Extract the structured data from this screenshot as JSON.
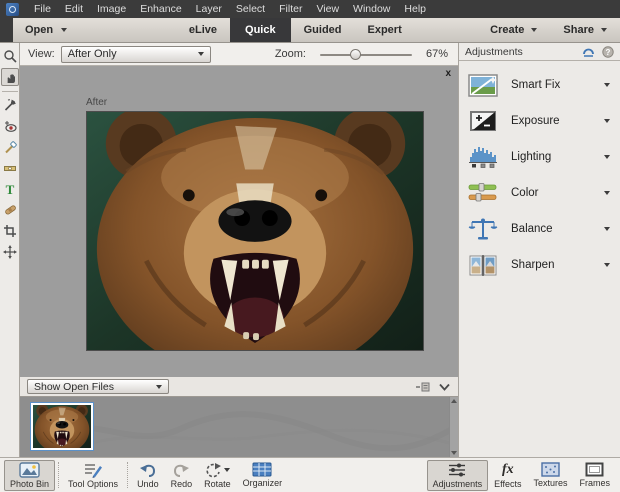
{
  "menubar": {
    "items": [
      "File",
      "Edit",
      "Image",
      "Enhance",
      "Layer",
      "Select",
      "Filter",
      "View",
      "Window",
      "Help"
    ]
  },
  "modebar": {
    "open_label": "Open",
    "tabs": [
      {
        "label": "eLive"
      },
      {
        "label": "Quick",
        "active": true
      },
      {
        "label": "Guided"
      },
      {
        "label": "Expert"
      }
    ],
    "create_label": "Create",
    "share_label": "Share"
  },
  "viewbar": {
    "view_label": "View:",
    "view_value": "After Only",
    "zoom_label": "Zoom:",
    "zoom_percent": "67%",
    "zoom_handle_position_pct": 33
  },
  "canvas": {
    "photo_label": "After",
    "close_glyph": "x"
  },
  "adjustments_panel": {
    "title": "Adjustments",
    "items": [
      {
        "label": "Smart Fix",
        "icon": "smart-fix-icon"
      },
      {
        "label": "Exposure",
        "icon": "exposure-icon"
      },
      {
        "label": "Lighting",
        "icon": "lighting-icon"
      },
      {
        "label": "Color",
        "icon": "color-icon"
      },
      {
        "label": "Balance",
        "icon": "balance-icon"
      },
      {
        "label": "Sharpen",
        "icon": "sharpen-icon"
      }
    ]
  },
  "binbar": {
    "dropdown_value": "Show Open Files"
  },
  "taskbar": {
    "left": [
      {
        "label": "Photo Bin",
        "icon": "photo-bin-icon",
        "active": true
      },
      {
        "label": "Tool Options",
        "icon": "tool-options-icon"
      },
      {
        "label": "Undo",
        "icon": "undo-icon"
      },
      {
        "label": "Redo",
        "icon": "redo-icon"
      },
      {
        "label": "Rotate",
        "icon": "rotate-icon"
      },
      {
        "label": "Organizer",
        "icon": "organizer-icon"
      }
    ],
    "right": [
      {
        "label": "Adjustments",
        "icon": "adjustments-sliders-icon",
        "active": true
      },
      {
        "label": "Effects",
        "icon": "effects-icon",
        "glyph": "fx"
      },
      {
        "label": "Textures",
        "icon": "textures-icon"
      },
      {
        "label": "Frames",
        "icon": "frames-icon"
      }
    ]
  },
  "tools": [
    "zoom-tool",
    "hand-tool",
    "quick-selection-tool",
    "red-eye-tool",
    "whiten-teeth-tool",
    "straighten-tool",
    "type-tool",
    "spot-healing-tool",
    "crop-tool",
    "move-tool"
  ],
  "colors": {
    "accent_blue": "#3f76b4",
    "tab_dark": "#38383a",
    "menubar_bg": "#3b3b3b",
    "canvas_bg": "#9d9d9d",
    "panel_bg": "#eceae7",
    "selection_blue": "#5a90c8"
  }
}
